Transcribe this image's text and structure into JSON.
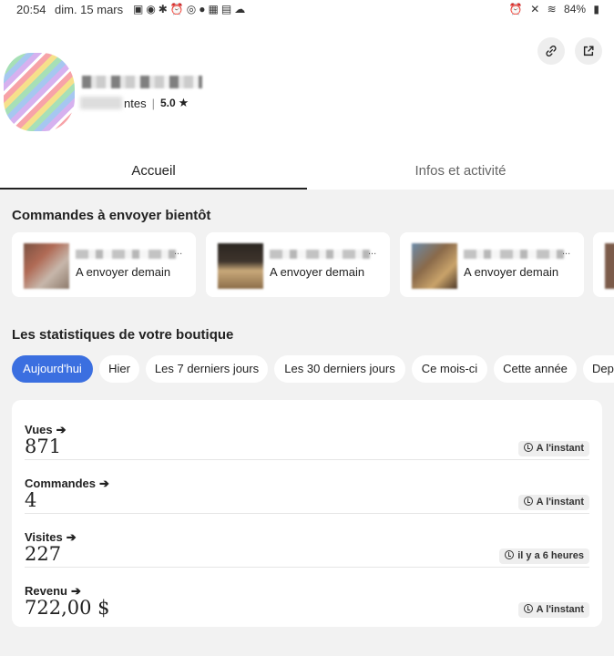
{
  "status_bar": {
    "time": "20:54",
    "date": "dim. 15 mars",
    "battery": "84%"
  },
  "shop": {
    "sales_suffix": "ntes",
    "rating": "5.0"
  },
  "tabs": [
    {
      "label": "Accueil",
      "active": true
    },
    {
      "label": "Infos et activité",
      "active": false
    }
  ],
  "orders_section": {
    "title": "Commandes à envoyer bientôt",
    "cards": [
      {
        "label": "A envoyer demain"
      },
      {
        "label": "A envoyer demain"
      },
      {
        "label": "A envoyer demain"
      }
    ],
    "ellipsis": "..."
  },
  "stats_section": {
    "title": "Les statistiques de votre boutique",
    "filters": [
      {
        "label": "Aujourd'hui",
        "active": true
      },
      {
        "label": "Hier",
        "active": false
      },
      {
        "label": "Les 7 derniers jours",
        "active": false
      },
      {
        "label": "Les 30 derniers jours",
        "active": false
      },
      {
        "label": "Ce mois-ci",
        "active": false
      },
      {
        "label": "Cette année",
        "active": false
      },
      {
        "label": "Dep",
        "active": false
      }
    ],
    "rows": [
      {
        "label": "Vues",
        "value": "871",
        "updated": "A l'instant"
      },
      {
        "label": "Commandes",
        "value": "4",
        "updated": "A l'instant"
      },
      {
        "label": "Visites",
        "value": "227",
        "updated": "il y a 6 heures"
      },
      {
        "label": "Revenu",
        "value": "722,00 $",
        "updated": "A l'instant"
      }
    ]
  },
  "colors": {
    "accent": "#3b6fe0",
    "background": "#f2f2f2"
  }
}
